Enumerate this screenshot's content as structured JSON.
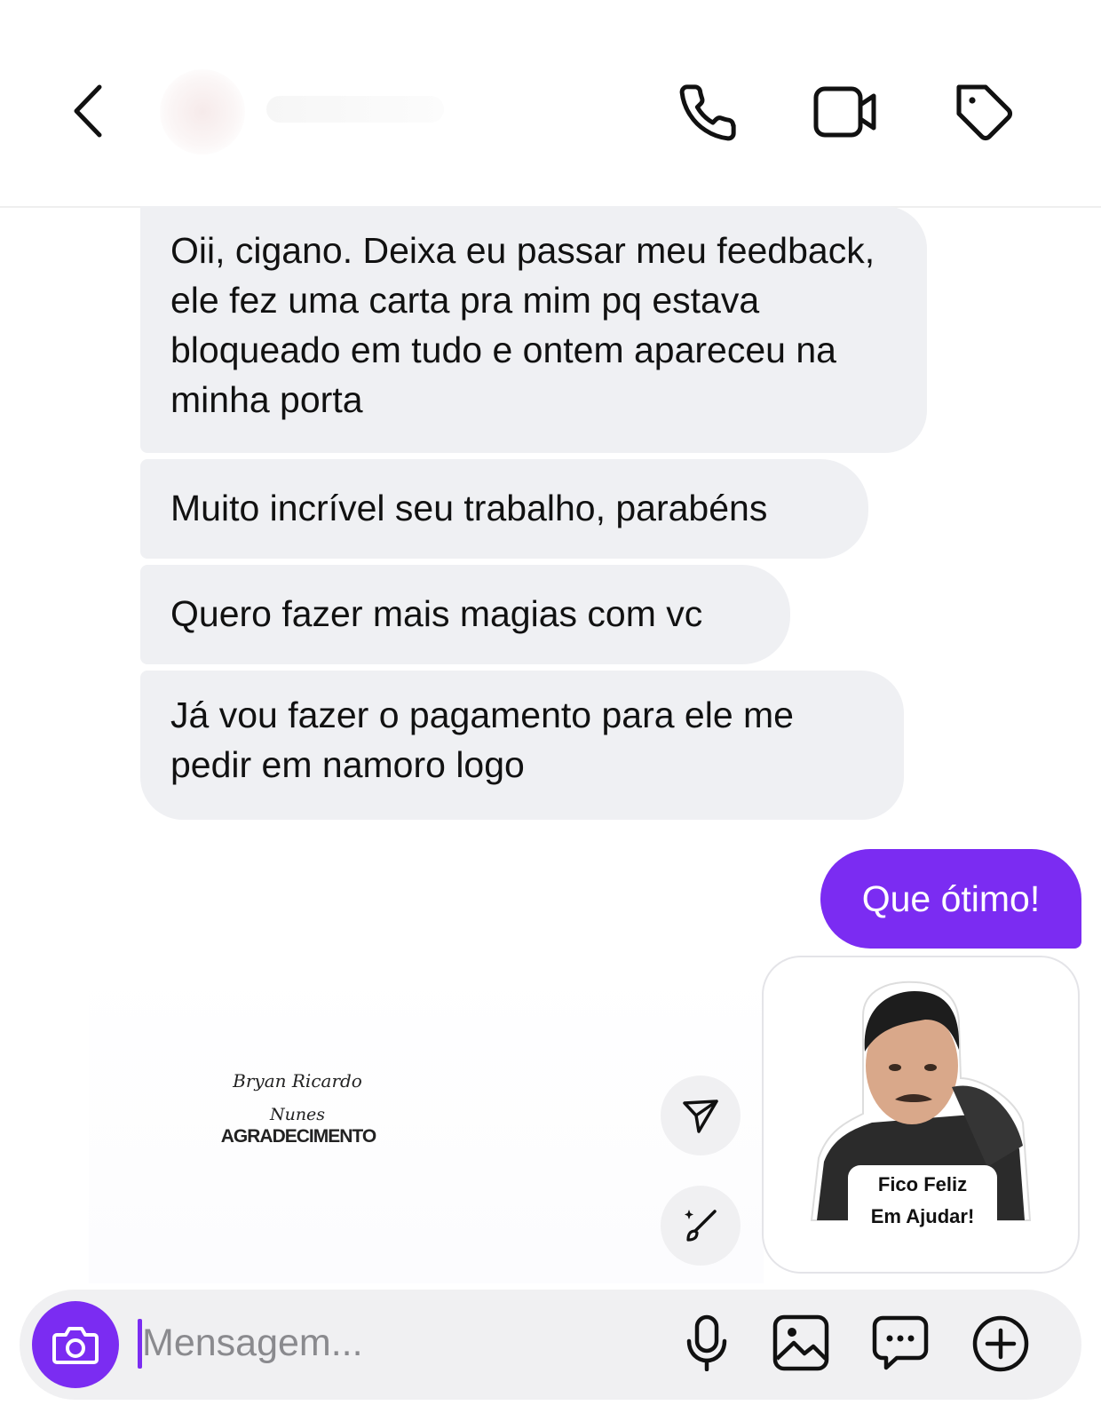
{
  "header": {
    "back_icon": "chevron-left-icon",
    "call_icon": "phone-icon",
    "video_icon": "video-camera-icon",
    "tag_icon": "tag-icon"
  },
  "messages": [
    {
      "direction": "received",
      "text": "Oii, cigano. Deixa eu passar meu feedback, ele fez uma carta pra mim pq estava bloqueado em tudo e ontem apareceu na minha porta"
    },
    {
      "direction": "received",
      "text": "Muito incrível seu trabalho, parabéns"
    },
    {
      "direction": "received",
      "text": "Quero fazer mais magias com vc"
    },
    {
      "direction": "received",
      "text": "Já vou fazer o pagamento para ele me pedir em namoro logo"
    },
    {
      "direction": "sent",
      "text": "Que ótimo!"
    }
  ],
  "signature": {
    "line1": "Bryan Ricardo",
    "line2": "Nunes",
    "title": "AGRADECIMENTO"
  },
  "sticker": {
    "caption_line1": "Fico Feliz",
    "caption_line2": "Em Ajudar!"
  },
  "actions": {
    "send_icon": "paper-plane-icon",
    "edit_icon": "sparkle-brush-icon"
  },
  "composer": {
    "placeholder": "Mensagem...",
    "camera_icon": "camera-icon",
    "mic_icon": "microphone-icon",
    "gallery_icon": "image-icon",
    "chat_icon": "chat-bubble-icon",
    "add_icon": "plus-circle-icon"
  },
  "colors": {
    "accent": "#7b2cf2",
    "received_bubble": "#eff0f3",
    "background": "#ffffff"
  }
}
